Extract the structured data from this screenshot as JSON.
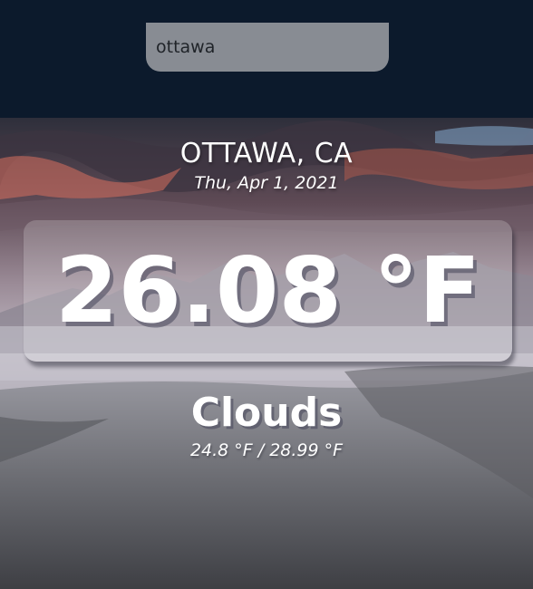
{
  "search": {
    "value": "ottawa",
    "placeholder": ""
  },
  "weather": {
    "location": "OTTAWA, CA",
    "date": "Thu, Apr 1, 2021",
    "temperature": "26.08 °F",
    "condition": "Clouds",
    "hi_lo": "24.8 °F / 28.99 °F"
  },
  "colors": {
    "header_bg": "#0c1a2c",
    "search_bg": "#888c93",
    "text": "#ffffff"
  }
}
